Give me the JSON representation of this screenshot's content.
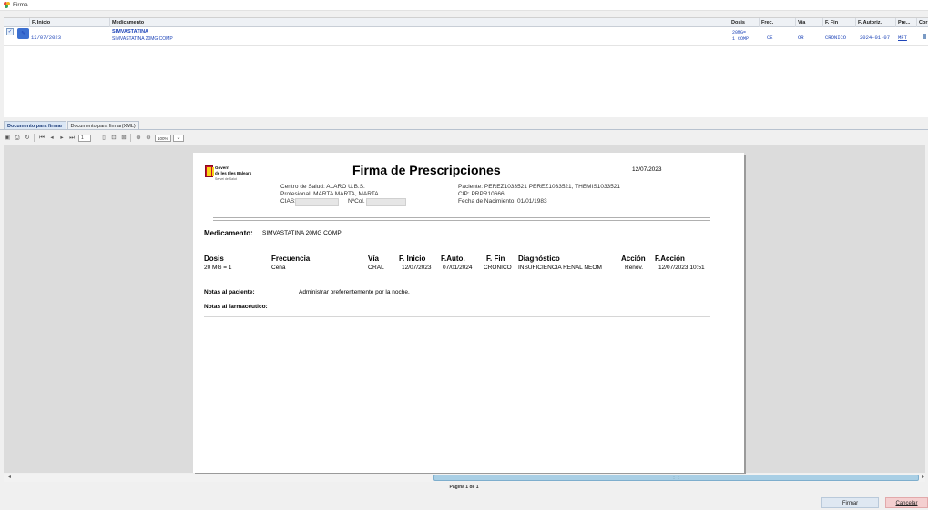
{
  "window": {
    "title": "Firma"
  },
  "grid": {
    "columns": [
      "F. Inicio",
      "Medicamento",
      "Dosis",
      "Frec.",
      "Vía",
      "F. Fin",
      "F. Autoriz.",
      "Pre...",
      "Cor"
    ],
    "row": {
      "inicio": "12/07/2023",
      "medicamento": "SIMVASTATINA",
      "medicamento_detalle": "SIMVASTATINA 20MG COMP",
      "dosis_1": "20MG=",
      "dosis_2": "1 COMP",
      "frec": "CE",
      "via": "OR",
      "fin": "CRONICO",
      "autoriz": "2024-01-07",
      "pre": "MFT"
    }
  },
  "tabs": [
    "Documento para firmar",
    "Documento para firmar(XML)"
  ],
  "toolbar": {
    "page": "1",
    "zoom": "100%"
  },
  "document": {
    "logo_line1": "Govern",
    "logo_line2": "de les Illes Balears",
    "logo_line3": "Servei de Salut",
    "title": "Firma de Prescripciones",
    "date": "12/07/2023",
    "centro": "Centro de Salud: ALARO U.B.S.",
    "profesional": "Profesional: MARTA MARTA, MARTA",
    "cias_label": "CIAS:",
    "ncol_label": "NºCol.",
    "paciente": "Paciente: PEREZ1033521 PEREZ1033521, THEMIS1033521",
    "cip": "CIP: PRPR10666",
    "nacimiento": "Fecha de Nacimiento: 01/01/1983",
    "medicamento_label": "Medicamento:",
    "medicamento_value": "SIMVASTATINA 20MG COMP",
    "headers": {
      "dosis": "Dosis",
      "frecuencia": "Frecuencia",
      "via": "Vía",
      "inicio": "F. Inicio",
      "auto": "F.Auto.",
      "fin": "F. Fin",
      "diagnostico": "Diagnóstico",
      "accion": "Acción",
      "faccion": "F.Acción"
    },
    "values": {
      "dosis": "20 MG = 1",
      "frecuencia": "Cena",
      "via": "ORAL",
      "inicio": "12/07/2023",
      "auto": "07/01/2024",
      "fin": "CRONICO",
      "diagnostico": "INSUFICIENCIA RENAL NEOM",
      "accion": "Renov.",
      "faccion": "12/07/2023 10:51"
    },
    "notas_paciente_label": "Notas al paciente:",
    "notas_paciente_value": "Administrar preferentemente por la noche.",
    "notas_farm_label": "Notas al farmacéutico:"
  },
  "footer": {
    "page_info": "Pagina 1 de 1"
  },
  "buttons": {
    "firmar": "Firmar",
    "cancelar": "Cancelar"
  },
  "colors": {
    "accent": "#1d44b8",
    "scroll_thumb": "#a9cfe5",
    "cancel_bg": "#f4cfd0",
    "logo_red": "#c8102e"
  }
}
